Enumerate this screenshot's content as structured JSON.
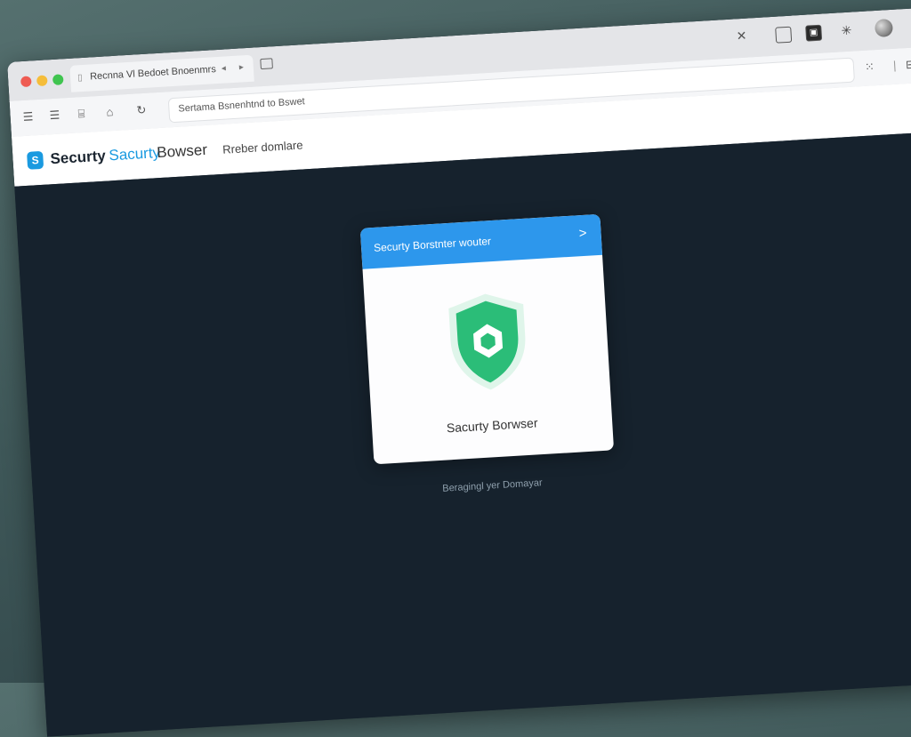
{
  "tabbar": {
    "tab_title": "Recnna Vl Bedoet Bnoenmrs",
    "tab_back": "◂",
    "tab_forward": "▸",
    "new_tab": "⊟",
    "close": "✕"
  },
  "toolbar": {
    "address_text": "Sertama Bsnenhtnd to Bswet"
  },
  "page_header": {
    "logo_glyph": "S",
    "logo_word_1": "Securty",
    "logo_word_2": "Sacurty",
    "logo_word_3": "Bowser",
    "nav_link": "Rreber domlare"
  },
  "card": {
    "header_title": "Securty Borstnter wouter",
    "header_icon": ">",
    "caption": "Sacurty Borwser"
  },
  "status": {
    "loading_text": "Beragingl yer Domayar"
  },
  "icons": {
    "menu": "☰",
    "home": "⌂",
    "refresh": "↻",
    "grid": "⁙",
    "split": "⊟"
  },
  "colors": {
    "accent": "#2d97ec",
    "shield": "#2bbd78",
    "background": "#16222d"
  }
}
